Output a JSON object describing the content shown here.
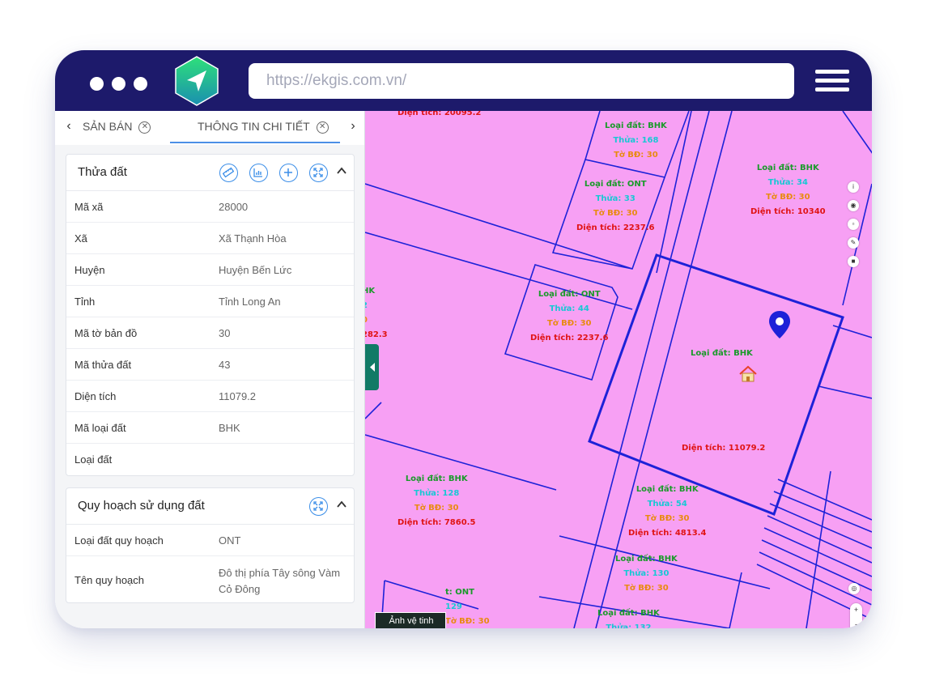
{
  "browser": {
    "url": "https://ekgis.com.vn/",
    "colors": {
      "topbar": "#1d1a6b",
      "logo_gradient_top": "#2ee07a",
      "logo_gradient_bottom": "#1a8fb0"
    }
  },
  "tabs": {
    "items": [
      {
        "label": "SẢN BÁN",
        "close_icon": "close-circle-icon"
      },
      {
        "label": "THÔNG TIN CHI TIẾT",
        "close_icon": "close-circle-icon",
        "active": true
      }
    ],
    "prev_icon": "chevron-left-icon",
    "next_icon": "chevron-right-icon",
    "accent": "#4b8fe6"
  },
  "parcel": {
    "title": "Thửa đất",
    "actions": [
      "ruler-icon",
      "chart-icon",
      "plus-circle-icon",
      "expand-icon",
      "chevron-up-icon"
    ],
    "rows": [
      {
        "key": "Mã xã",
        "value": "28000"
      },
      {
        "key": "Xã",
        "value": "Xã Thạnh Hòa"
      },
      {
        "key": "Huyện",
        "value": "Huyện Bến Lức"
      },
      {
        "key": "Tỉnh",
        "value": "Tỉnh Long An"
      },
      {
        "key": "Mã tờ bản đồ",
        "value": "30"
      },
      {
        "key": "Mã thửa đất",
        "value": "43"
      },
      {
        "key": "Diện tích",
        "value": "11079.2"
      },
      {
        "key": "Mã loại đất",
        "value": "BHK"
      },
      {
        "key": "Loại đất",
        "value": ""
      }
    ]
  },
  "planning": {
    "title": "Quy hoạch sử dụng đất",
    "actions": [
      "expand-icon",
      "chevron-up-icon"
    ],
    "rows": [
      {
        "key": "Loại đất quy hoạch",
        "value": "ONT"
      },
      {
        "key": "Tên quy hoạch",
        "value": "Đô thị phía Tây sông Vàm Cỏ Đông"
      }
    ]
  },
  "map": {
    "background": "#f7a0f4",
    "boundary_color": "#1d22d8",
    "labels": {
      "top_cut": "Diện tích: 20095.2",
      "p168": {
        "type": "Loại đất: BHK",
        "parcel": "Thửa: 168",
        "sheet": "Tờ BĐ: 30"
      },
      "p33": {
        "type": "Loại đất: ONT",
        "parcel": "Thửa: 33",
        "sheet": "Tờ BĐ: 30",
        "area": "Diện tích: 2237.6"
      },
      "p34": {
        "type": "Loại đất: BHK",
        "parcel": "Thửa: 34",
        "sheet": "Tờ BĐ: 30",
        "area": "Diện tích: 10340"
      },
      "left_cut": {
        "type": "HK",
        "parcel": "2",
        "sheet": "0",
        "area": "282.3"
      },
      "p44": {
        "type": "Loại đất: ONT",
        "parcel": "Thửa: 44",
        "sheet": "Tờ BĐ: 30",
        "area": "Diện tích: 2237.6"
      },
      "p43": {
        "type": "Loại đất: BHK",
        "area": "Diện tích: 11079.2"
      },
      "p128": {
        "type": "Loại đất: BHK",
        "parcel": "Thửa: 128",
        "sheet": "Tờ BĐ: 30",
        "area": "Diện tích: 7860.5"
      },
      "p54": {
        "type": "Loại đất: BHK",
        "parcel": "Thửa: 54",
        "sheet": "Tờ BĐ: 30",
        "area": "Diện tích: 4813.4"
      },
      "p130": {
        "type": "Loại đất: BHK",
        "parcel": "Thửa: 130",
        "sheet": "Tờ BĐ: 30"
      },
      "p129": {
        "type": "t: ONT",
        "parcel": "129",
        "sheet": "Tờ BĐ: 30"
      },
      "p_bottom": {
        "type": "Loại đất: BHK",
        "parcel": "Thửa: 132"
      }
    },
    "satellite_label": "Ảnh vệ tinh",
    "tools": [
      "info-icon",
      "eye-icon",
      "eraser-icon",
      "pen-icon",
      "trash-icon"
    ],
    "zoom": {
      "in": "+",
      "reset": "-",
      "out": "↑"
    }
  }
}
